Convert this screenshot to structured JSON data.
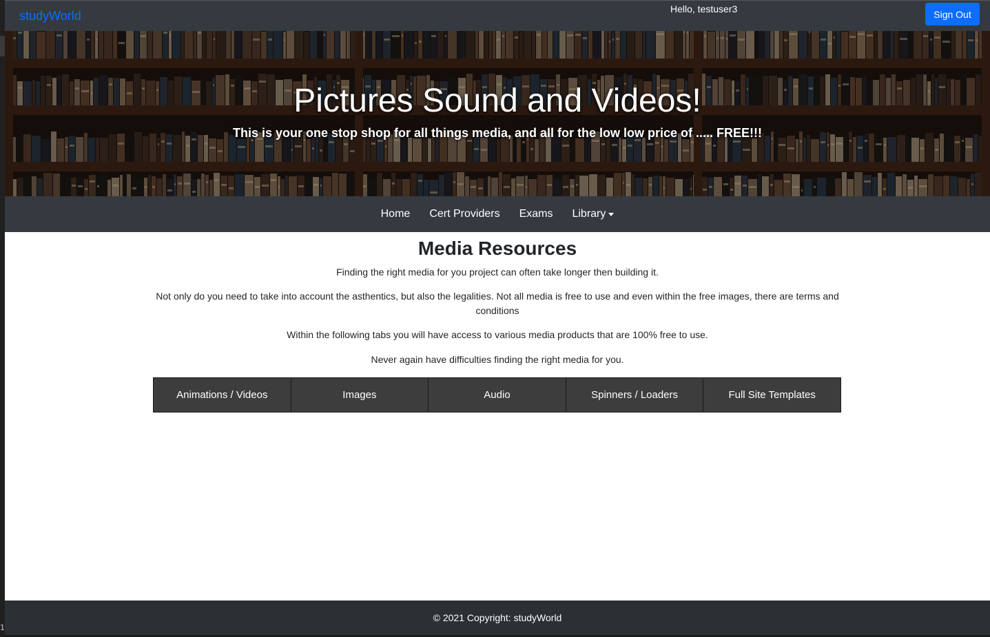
{
  "topbar": {
    "brand": "studyWorld",
    "greeting": "Hello, testuser3",
    "signout_label": "Sign Out"
  },
  "hero": {
    "title": "Pictures Sound and Videos!",
    "subtitle": "This is your one stop shop for all things media, and all for the low low price of ..... FREE!!!"
  },
  "nav": {
    "items": [
      {
        "label": "Home"
      },
      {
        "label": "Cert Providers"
      },
      {
        "label": "Exams"
      },
      {
        "label": "Library"
      }
    ]
  },
  "main": {
    "heading": "Media Resources",
    "paragraphs": [
      "Finding the right media for you project can often take longer then building it.",
      "Not only do you need to take into account the asthentics, but also the legalities. Not all media is free to use and even within the free images, there are terms and conditions",
      "Within the following tabs you will have access to various media products that are 100% free to use.",
      "Never again have difficulties finding the right media for you."
    ],
    "tabs": [
      {
        "label": "Animations / Videos"
      },
      {
        "label": "Images"
      },
      {
        "label": "Audio"
      },
      {
        "label": "Spinners / Loaders"
      },
      {
        "label": "Full Site Templates"
      }
    ]
  },
  "footer": {
    "text": "© 2021 Copyright: studyWorld"
  },
  "gutter": {
    "line_number": "1"
  }
}
